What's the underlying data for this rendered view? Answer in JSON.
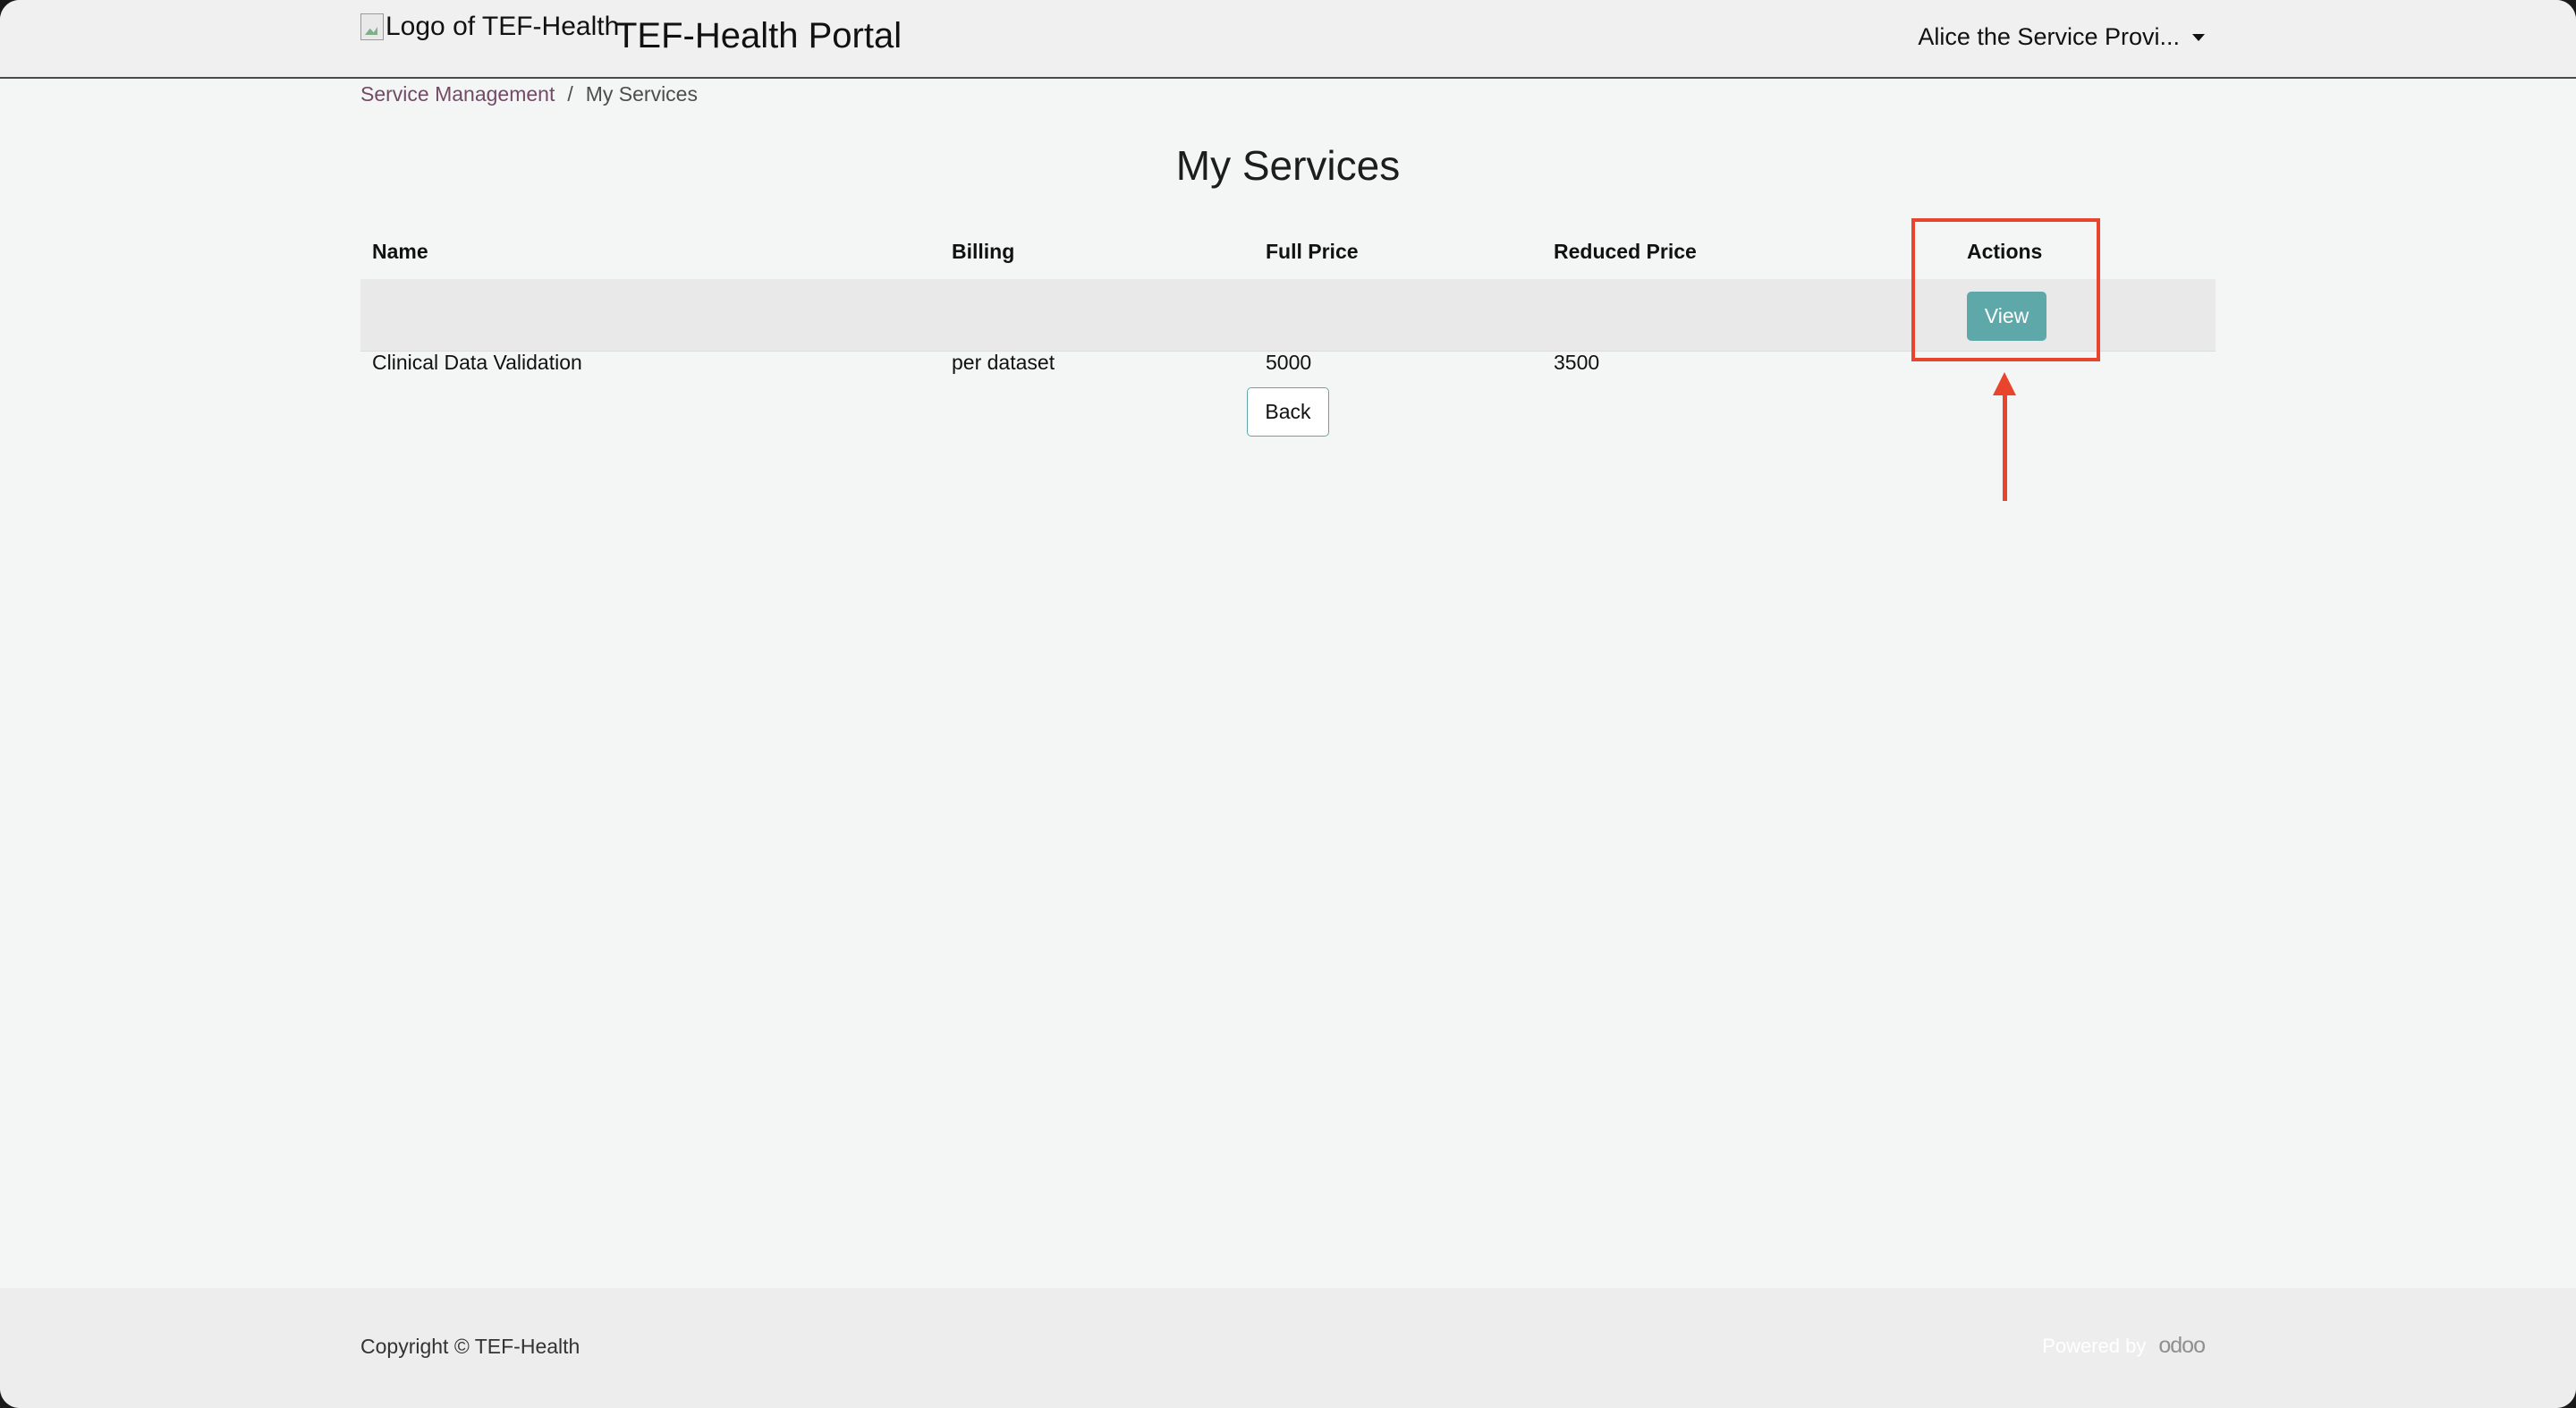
{
  "header": {
    "logo_alt": "Logo of TEF-Health",
    "portal_title": "TEF-Health Portal",
    "user_menu_label": "Alice the Service Provi..."
  },
  "breadcrumb": {
    "parent": "Service Management",
    "separator": "/",
    "current": "My Services"
  },
  "page_title": "My Services",
  "table": {
    "columns": [
      "Name",
      "Billing",
      "Full Price",
      "Reduced Price",
      "Actions"
    ],
    "rows": [
      {
        "name": "Clinical Data Validation",
        "billing": "per dataset",
        "full_price": "5000",
        "reduced_price": "3500",
        "action_label": "View"
      }
    ]
  },
  "back_label": "Back",
  "footer": {
    "copyright": "Copyright © TEF-Health",
    "powered_by": "Powered by",
    "brand": "odoo"
  },
  "colors": {
    "accent_teal": "#5fa8a9",
    "link_purple": "#714b67",
    "annotation_red": "#e8452c"
  }
}
